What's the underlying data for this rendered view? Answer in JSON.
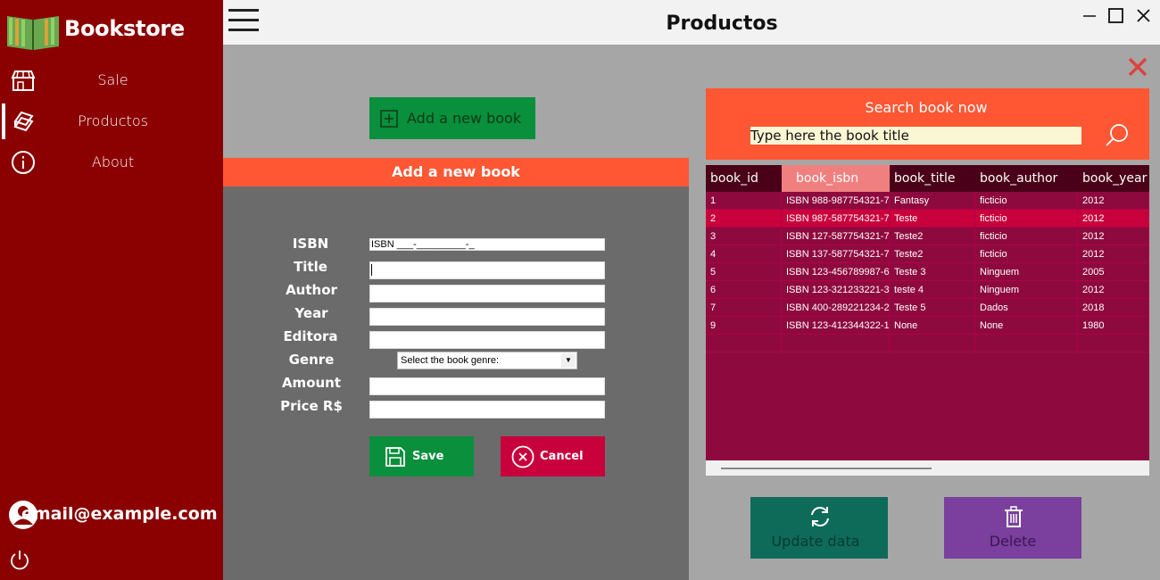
{
  "sidebar": {
    "brand": "Bookstore",
    "items": [
      {
        "label": "Sale",
        "icon": "store-icon"
      },
      {
        "label": "Productos",
        "icon": "books-icon",
        "active": true
      },
      {
        "label": "About",
        "icon": "info-icon"
      }
    ],
    "user_email": "email@example.com"
  },
  "header": {
    "title": "Productos"
  },
  "form": {
    "top_button_label": "Add a new book",
    "header": "Add a new book",
    "labels": {
      "isbn": "ISBN",
      "title": "Title",
      "author": "Author",
      "year": "Year",
      "editora": "Editora",
      "genre": "Genre",
      "amount": "Amount",
      "price": "Price R$"
    },
    "isbn_mask": "ISBN ___-_________-_",
    "genre_placeholder": "Select the  book genre:",
    "save_label": "Save",
    "cancel_label": "Cancel"
  },
  "search": {
    "title": "Search book now",
    "placeholder": "Type here the book title"
  },
  "grid": {
    "columns": [
      "book_id",
      "book_isbn",
      "book_title",
      "book_author",
      "book_year"
    ],
    "selected_column": 1,
    "selected_row": 1,
    "rows": [
      [
        "1",
        "ISBN 988-987754321-7",
        "Fantasy",
        "ficticio",
        "2012"
      ],
      [
        "2",
        "ISBN 987-587754321-7",
        "Teste",
        "ficticio",
        "2012"
      ],
      [
        "3",
        "ISBN 127-587754321-7",
        "Teste2",
        "ficticio",
        "2012"
      ],
      [
        "4",
        "ISBN 137-587754321-7",
        "Teste2",
        "ficticio",
        "2012"
      ],
      [
        "5",
        "ISBN 123-456789987-6",
        "Teste 3",
        "Ninguem",
        "2005"
      ],
      [
        "6",
        "ISBN 123-321233221-3",
        "teste 4",
        "Ninguem",
        "2012"
      ],
      [
        "7",
        "ISBN 400-289221234-2",
        "Teste 5",
        "Dados",
        "2018"
      ],
      [
        "9",
        "ISBN 123-412344322-1",
        "None",
        "None",
        "1980"
      ],
      [
        "",
        "",
        "",
        "",
        ""
      ]
    ]
  },
  "actions": {
    "update_label": "Update data",
    "delete_label": "Delete"
  },
  "colors": {
    "sidebar": "#8b0000",
    "accent_orange": "#ff5733",
    "green": "#0a8f3c",
    "crimson": "#c8003c",
    "grid_bg": "#8e0a3e",
    "teal": "#0e6b5a",
    "purple": "#7b3f9e"
  }
}
